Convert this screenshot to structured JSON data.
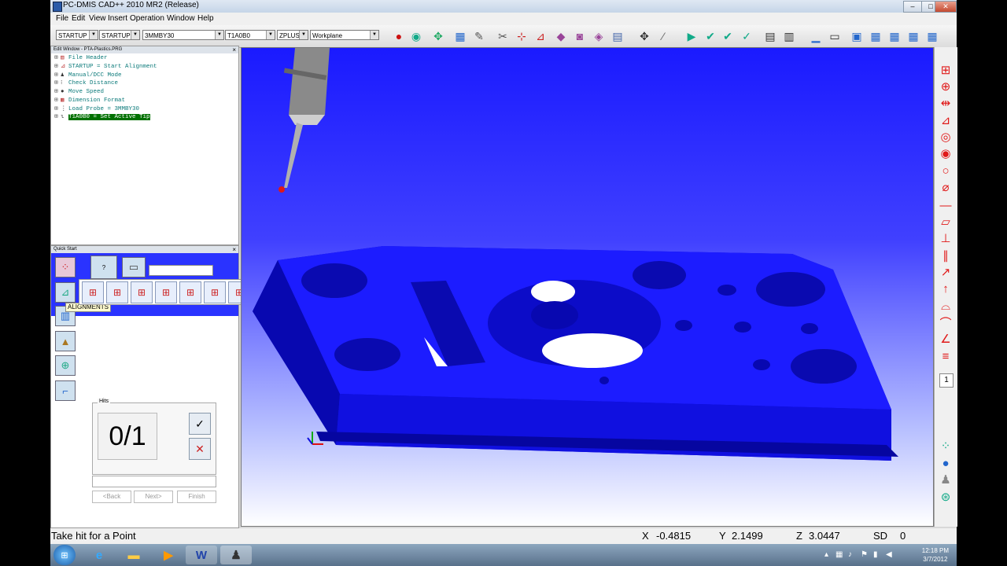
{
  "window": {
    "title": "PC-DMIS CAD++ 2010 MR2 (Release)",
    "minimize": "‒",
    "maximize": "□",
    "close": "✕"
  },
  "menu": [
    {
      "label": "File"
    },
    {
      "label": "Edit"
    },
    {
      "label": "View"
    },
    {
      "label": "Insert"
    },
    {
      "label": "Operation"
    },
    {
      "label": "Window"
    },
    {
      "label": "Help"
    }
  ],
  "toolbar": {
    "combo_alignment": "STARTUP",
    "combo_alignment2": "STARTUP",
    "combo_probe": "3MMBY30",
    "combo_tip": "T1A0B0",
    "combo_plane": "ZPLUS",
    "combo_workplane": "Workplane"
  },
  "edit_window": {
    "title": "Edit Window - PTA-Plastics.PRG",
    "close": "×",
    "items": [
      {
        "label": "File Header",
        "icon": "file-header-icon"
      },
      {
        "label": "STARTUP = Start Alignment",
        "icon": "alignment-icon"
      },
      {
        "label": "Manual/DCC Mode",
        "icon": "mode-icon"
      },
      {
        "label": "Check Distance",
        "icon": "check-icon"
      },
      {
        "label": "Move Speed",
        "icon": "speed-icon"
      },
      {
        "label": "Dimension Format",
        "icon": "format-icon"
      },
      {
        "label": "Load Probe = 3MMBY30",
        "icon": "probe-icon"
      },
      {
        "label": "T1A0B0 = Set Active Tip",
        "icon": "tip-icon",
        "selected": true
      }
    ]
  },
  "quick_start": {
    "title": "Quick Start",
    "close": "×",
    "tooltip": "ALIGNMENTS",
    "hits_label": "Hits",
    "hits_value": "0/1",
    "back_button": "<Back",
    "next_button": "Next>",
    "finish_button": "Finish",
    "help_button": "?"
  },
  "status_bar": {
    "message": "Take hit for a Point",
    "x_label": "X",
    "x_value": "-0.4815",
    "y_label": "Y",
    "y_value": "2.1499",
    "z_label": "Z",
    "z_value": "3.0447",
    "sd_label": "SD",
    "sd_value": "0"
  },
  "right_toolbar": {
    "counter": "1"
  },
  "taskbar": {
    "apps": [
      "start-orb",
      "internet-explorer",
      "file-explorer",
      "media-player",
      "word",
      "pc-dmis"
    ],
    "word_label": "W",
    "time": "12:18 PM",
    "date": "3/7/2012"
  },
  "colors": {
    "part": "#1414ff",
    "viewport_top": "#1a1aff",
    "probe_tip": "#e01818",
    "selection": "#007000"
  }
}
